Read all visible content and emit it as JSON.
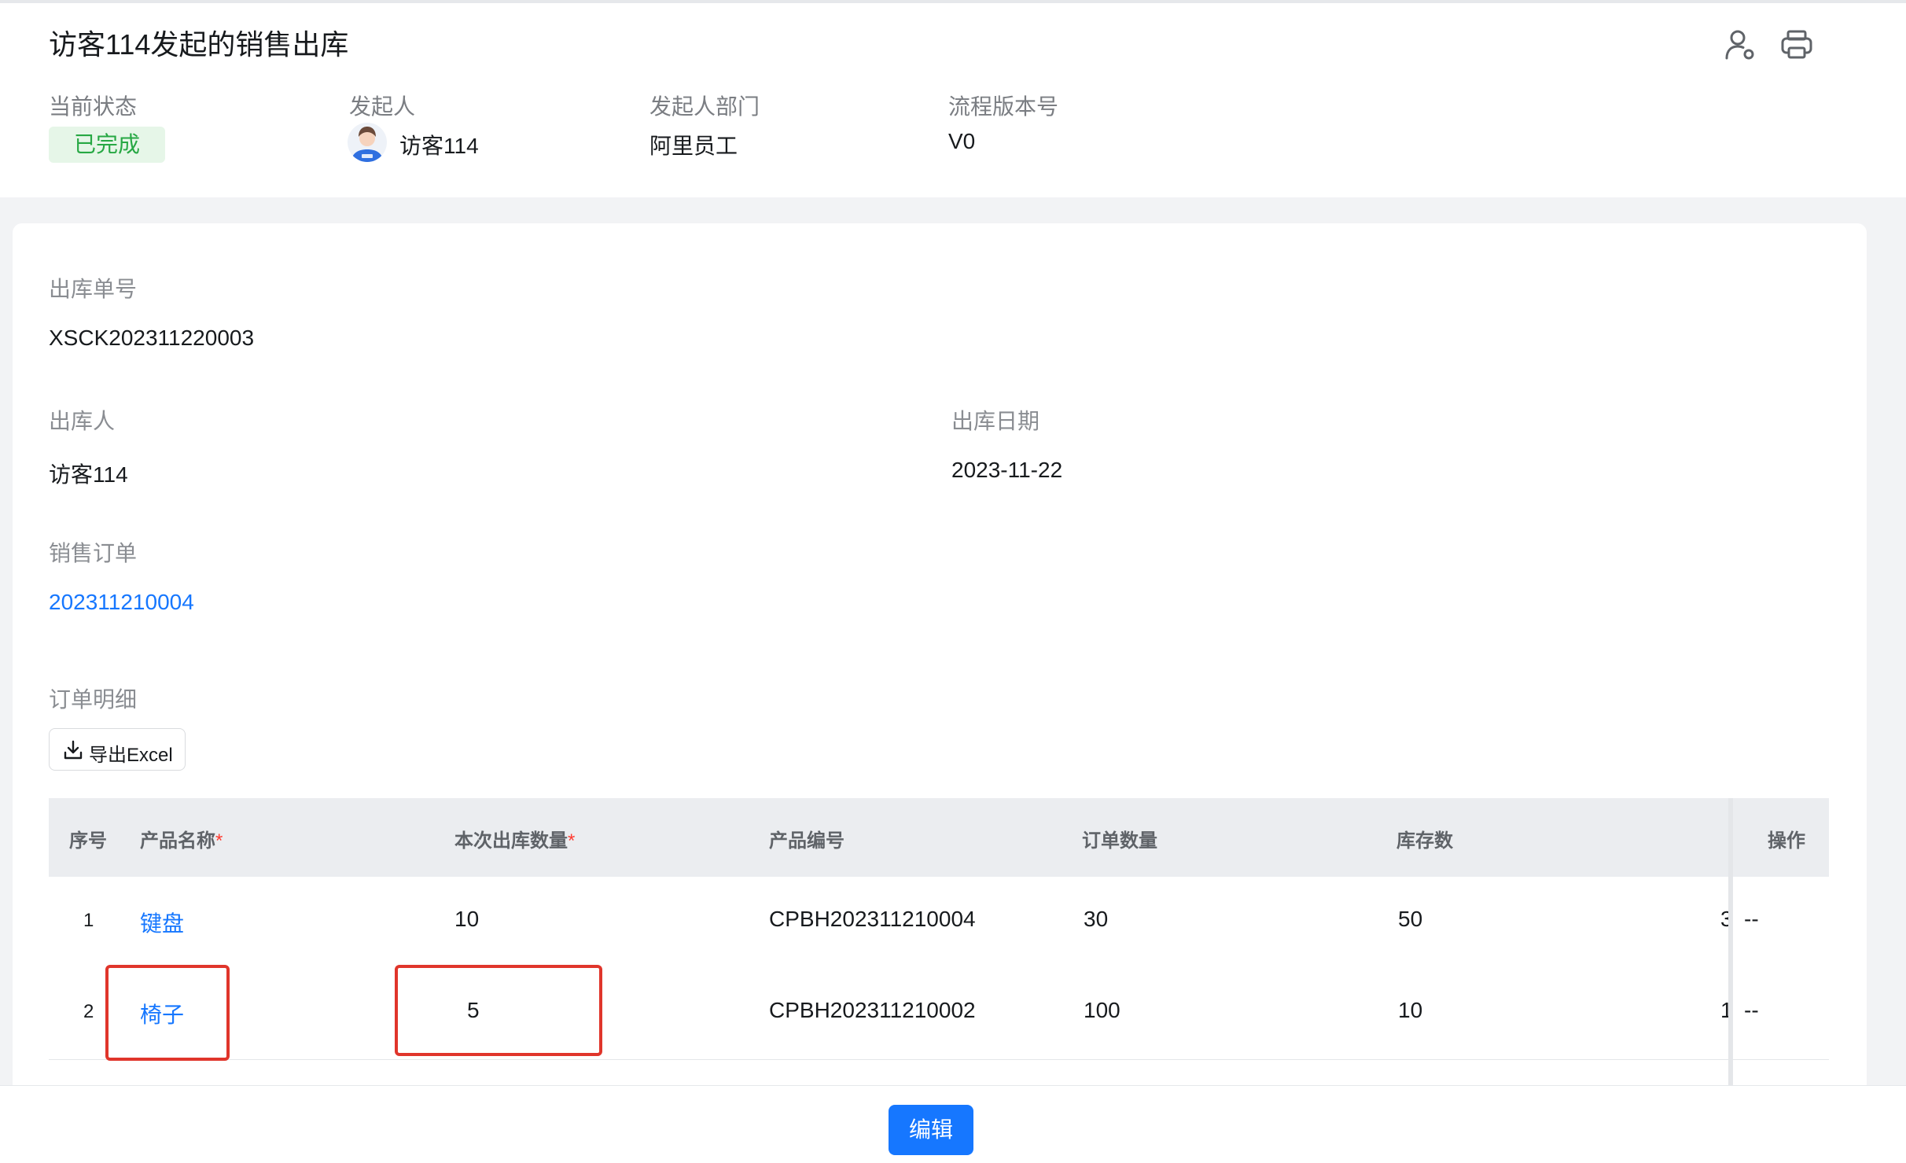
{
  "header": {
    "title": "访客114发起的销售出库",
    "meta": [
      {
        "label": "当前状态",
        "value": "已完成"
      },
      {
        "label": "发起人",
        "value": "访客114"
      },
      {
        "label": "发起人部门",
        "value": "阿里员工"
      },
      {
        "label": "流程版本号",
        "value": "V0"
      }
    ],
    "icons": [
      "user-settings-icon",
      "printer-icon"
    ],
    "colors": {
      "status": "#27a844",
      "accent": "#1677ff"
    }
  },
  "form": {
    "outbound_no": {
      "label": "出库单号",
      "value": "XSCK202311220003"
    },
    "operator": {
      "label": "出库人",
      "value": "访客114"
    },
    "date": {
      "label": "出库日期",
      "value": "2023-11-22"
    },
    "sales_order": {
      "label": "销售订单",
      "value": "202311210004"
    },
    "details": {
      "label": "订单明细",
      "export_label": "导出Excel"
    }
  },
  "table": {
    "columns": [
      "序号",
      "产品名称",
      "本次出库数量",
      "产品编号",
      "订单数量",
      "库存数",
      "操作"
    ],
    "required_mark": "*",
    "rows": [
      {
        "index": "1",
        "name": "键盘",
        "qty": "10",
        "code": "CPBH202311210004",
        "order_qty": "30",
        "stock": "50",
        "clip": "3",
        "action": "--"
      },
      {
        "index": "2",
        "name": "椅子",
        "qty": "5",
        "code": "CPBH202311210002",
        "order_qty": "100",
        "stock": "10",
        "clip": "1",
        "action": "--"
      }
    ]
  },
  "footer": {
    "edit_label": "编辑"
  }
}
